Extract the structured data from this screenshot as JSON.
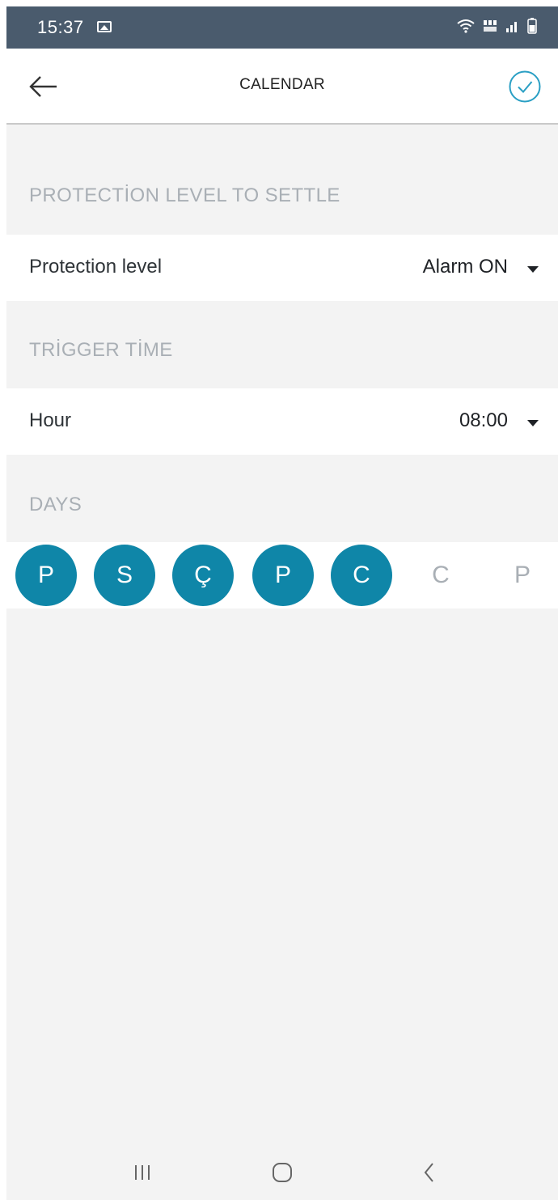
{
  "status_bar": {
    "time": "15:37"
  },
  "header": {
    "title": "CALENDAR"
  },
  "sections": {
    "protection": {
      "heading": "PROTECTİON LEVEL TO SETTLE",
      "label": "Protection level",
      "value": "Alarm ON"
    },
    "trigger": {
      "heading": "TRİGGER TİME",
      "label": "Hour",
      "value": "08:00"
    },
    "days": {
      "heading": "DAYS",
      "items": [
        {
          "label": "P",
          "selected": true
        },
        {
          "label": "S",
          "selected": true
        },
        {
          "label": "Ç",
          "selected": true
        },
        {
          "label": "P",
          "selected": true
        },
        {
          "label": "C",
          "selected": true
        },
        {
          "label": "C",
          "selected": false
        },
        {
          "label": "P",
          "selected": false
        }
      ]
    }
  },
  "colors": {
    "accent": "#0f86a8",
    "status_bar": "#4a5b6d",
    "muted_text": "#a9afb5",
    "background": "#f3f3f3"
  },
  "icons": {
    "back": "arrow-left-icon",
    "confirm": "check-circle-icon",
    "nav_recents": "recents-icon",
    "nav_home": "home-icon",
    "nav_back": "chevron-left-icon"
  }
}
